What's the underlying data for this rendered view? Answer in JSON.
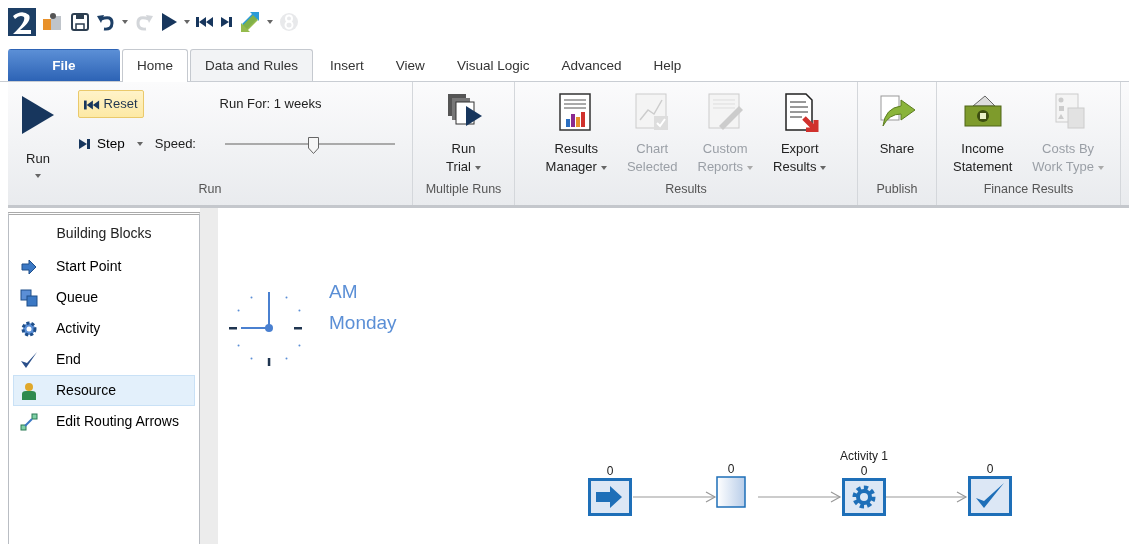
{
  "quick_access": [
    {
      "kind": "logo",
      "disabled": false,
      "dropdown": false
    },
    {
      "kind": "open",
      "disabled": false,
      "dropdown": false
    },
    {
      "kind": "save",
      "disabled": false,
      "dropdown": false
    },
    {
      "kind": "undo",
      "disabled": false,
      "dropdown": true
    },
    {
      "kind": "redo",
      "disabled": true,
      "dropdown": false
    },
    {
      "kind": "play",
      "disabled": false,
      "dropdown": true
    },
    {
      "kind": "reset",
      "disabled": false,
      "dropdown": false
    },
    {
      "kind": "step",
      "disabled": false,
      "dropdown": false
    },
    {
      "kind": "arrows",
      "disabled": false,
      "dropdown": true
    },
    {
      "kind": "eight",
      "disabled": true,
      "dropdown": false
    }
  ],
  "tabs": [
    {
      "label": "File",
      "kind": "file",
      "selected": false
    },
    {
      "label": "Home",
      "kind": "tab",
      "selected": true
    },
    {
      "label": "Data and Rules",
      "kind": "boxed",
      "selected": false
    },
    {
      "label": "Insert",
      "kind": "tab",
      "selected": false
    },
    {
      "label": "View",
      "kind": "tab",
      "selected": false
    },
    {
      "label": "Visual Logic",
      "kind": "tab",
      "selected": false
    },
    {
      "label": "Advanced",
      "kind": "tab",
      "selected": false
    },
    {
      "label": "Help",
      "kind": "tab",
      "selected": false
    }
  ],
  "run_group": {
    "label": "Run",
    "run_button": "Run",
    "reset_button": "Reset",
    "reset_highlighted": true,
    "run_for": "Run For: 1 weeks",
    "step_button": "Step",
    "speed_label": "Speed:",
    "speed": {
      "level": 0.5
    }
  },
  "ribbon_groups": [
    {
      "label": "Multiple Runs",
      "buttons": [
        {
          "kind": "trial",
          "lines": [
            "Run",
            "Trial"
          ],
          "dropdown": true,
          "disabled": false
        }
      ]
    },
    {
      "label": "Results",
      "buttons": [
        {
          "kind": "results",
          "lines": [
            "Results",
            "Manager"
          ],
          "dropdown": true,
          "disabled": false
        },
        {
          "kind": "chart",
          "lines": [
            "Chart",
            "Selected"
          ],
          "dropdown": false,
          "disabled": true
        },
        {
          "kind": "custom",
          "lines": [
            "Custom",
            "Reports"
          ],
          "dropdown": true,
          "disabled": true
        },
        {
          "kind": "export",
          "lines": [
            "Export",
            "Results"
          ],
          "dropdown": true,
          "disabled": false
        }
      ]
    },
    {
      "label": "Publish",
      "buttons": [
        {
          "kind": "share",
          "lines": [
            "Share"
          ],
          "dropdown": false,
          "disabled": false
        }
      ]
    },
    {
      "label": "Finance Results",
      "buttons": [
        {
          "kind": "money",
          "lines": [
            "Income",
            "Statement"
          ],
          "dropdown": false,
          "disabled": false
        },
        {
          "kind": "costs",
          "lines": [
            "Costs By",
            "Work Type"
          ],
          "dropdown": true,
          "disabled": true
        }
      ]
    }
  ],
  "sidebar": {
    "title": "Building Blocks",
    "items": [
      {
        "label": "Start Point",
        "kind": "start",
        "selected": false
      },
      {
        "label": "Queue",
        "kind": "queue",
        "selected": false
      },
      {
        "label": "Activity",
        "kind": "gear",
        "selected": false
      },
      {
        "label": "End",
        "kind": "check",
        "selected": false
      },
      {
        "label": "Resource",
        "kind": "person",
        "selected": true
      },
      {
        "label": "Edit Routing Arrows",
        "kind": "routing",
        "selected": false
      }
    ]
  },
  "canvas": {
    "clock": {
      "period": "AM",
      "day": "Monday"
    },
    "nodes": [
      {
        "kind": "start",
        "count": "0"
      },
      {
        "kind": "queue",
        "count": "0"
      },
      {
        "kind": "activity",
        "count": "0",
        "title": "Activity 1"
      },
      {
        "kind": "end",
        "count": "0"
      }
    ]
  }
}
